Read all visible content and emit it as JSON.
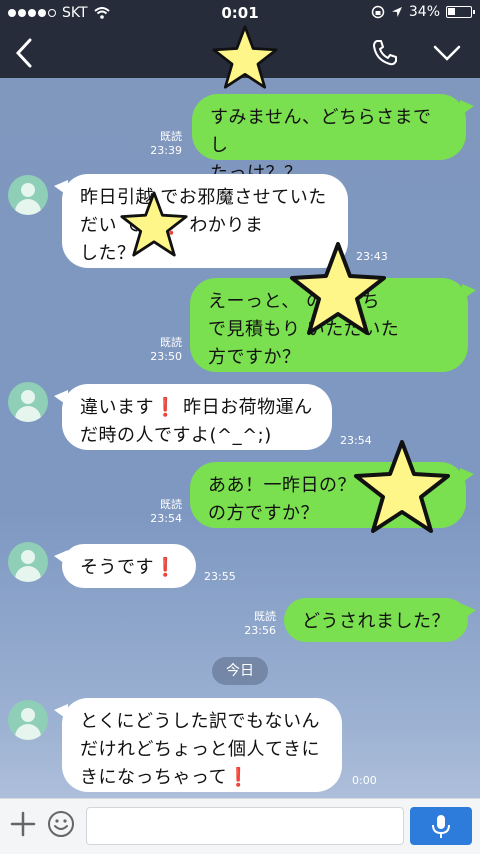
{
  "status_bar": {
    "carrier": "SKT",
    "time": "0:01",
    "battery": "34%",
    "battery_level": 0.34,
    "signal_bars": 4
  },
  "header": {
    "back_icon": "chevron-left-icon",
    "call_icon": "phone-icon",
    "menu_icon": "chevron-down-icon"
  },
  "messages": [
    {
      "dir": "out",
      "lines": [
        "すみません、どちらさまでし",
        "たっけ？？"
      ],
      "read": "既読",
      "time": "23:39"
    },
    {
      "dir": "in",
      "lines": [
        "昨日引越 でお邪魔させていた",
        "だい   です❗️ わかりま",
        "した？"
      ],
      "time": "23:43"
    },
    {
      "dir": "out",
      "lines": [
        "えーっと、          のおうち",
        "で見積もり           いただいた",
        "方ですか？"
      ],
      "read": "既読",
      "time": "23:50"
    },
    {
      "dir": "in",
      "lines": [
        "違います❗️ 昨日お荷物運ん",
        "だ時の人ですよ(^_^;)"
      ],
      "time": "23:54"
    },
    {
      "dir": "out",
      "lines": [
        "ああ！一昨日の？",
        "の方ですか？"
      ],
      "read": "既読",
      "time": "23:54"
    },
    {
      "dir": "in",
      "lines": [
        "そうです❗️"
      ],
      "time": "23:55"
    },
    {
      "dir": "out",
      "lines": [
        "どうされました？"
      ],
      "read": "既読",
      "time": "23:56"
    },
    {
      "dir": "in",
      "lines": [
        "とくにどうした訳でもないん",
        "だけれどちょっと個人てきに",
        "きになっちゃって❗️"
      ],
      "time": "0:00"
    }
  ],
  "date_divider": "今日",
  "input_bar": {
    "placeholder": "",
    "plus_icon": "plus-icon",
    "emoji_icon": "emoji-icon",
    "mic_icon": "microphone-icon"
  },
  "colors": {
    "header_bg": "#262c3a",
    "outgoing_bubble": "#7ae04f",
    "incoming_bubble": "#ffffff",
    "mic_button": "#2d7bdb",
    "star_fill": "#fff68a"
  }
}
